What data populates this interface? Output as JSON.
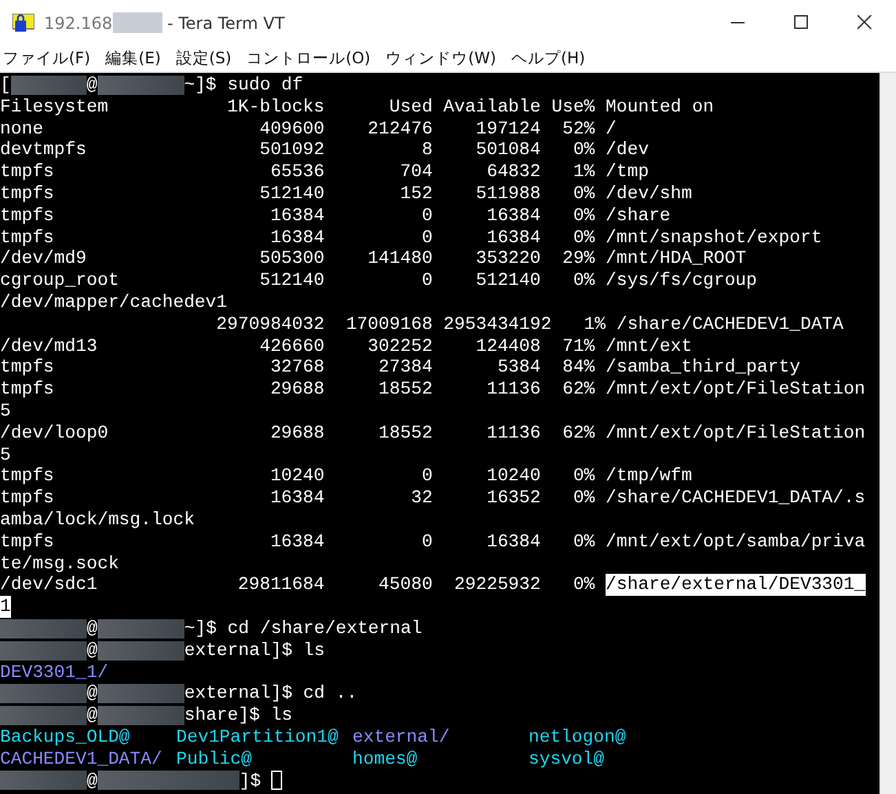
{
  "window": {
    "title_prefix": "192.168",
    "title_suffix": " - Tera Term VT"
  },
  "menu": [
    "ファイル(F)",
    "編集(E)",
    "設定(S)",
    "コントロール(O)",
    "ウィンドウ(W)",
    "ヘルプ(H)"
  ],
  "terminal": {
    "lines": [
      {
        "segments": [
          {
            "kind": "text",
            "text": "["
          },
          {
            "kind": "redacted_short"
          },
          {
            "kind": "text",
            "text": "@"
          },
          {
            "kind": "redacted"
          },
          {
            "kind": "text",
            "text": "~]$ sudo df"
          }
        ]
      },
      {
        "segments": [
          {
            "kind": "text",
            "text": "Filesystem           1K-blocks      Used Available Use% Mounted on"
          }
        ]
      },
      {
        "segments": [
          {
            "kind": "text",
            "text": "none                    409600    212476    197124  52% /"
          }
        ]
      },
      {
        "segments": [
          {
            "kind": "text",
            "text": "devtmpfs                501092         8    501084   0% /dev"
          }
        ]
      },
      {
        "segments": [
          {
            "kind": "text",
            "text": "tmpfs                    65536       704     64832   1% /tmp"
          }
        ]
      },
      {
        "segments": [
          {
            "kind": "text",
            "text": "tmpfs                   512140       152    511988   0% /dev/shm"
          }
        ]
      },
      {
        "segments": [
          {
            "kind": "text",
            "text": "tmpfs                    16384         0     16384   0% /share"
          }
        ]
      },
      {
        "segments": [
          {
            "kind": "text",
            "text": "tmpfs                    16384         0     16384   0% /mnt/snapshot/export"
          }
        ]
      },
      {
        "segments": [
          {
            "kind": "text",
            "text": "/dev/md9                505300    141480    353220  29% /mnt/HDA_ROOT"
          }
        ]
      },
      {
        "segments": [
          {
            "kind": "text",
            "text": "cgroup_root             512140         0    512140   0% /sys/fs/cgroup"
          }
        ]
      },
      {
        "segments": [
          {
            "kind": "text",
            "text": "/dev/mapper/cachedev1"
          }
        ]
      },
      {
        "segments": [
          {
            "kind": "text",
            "text": "                    2970984032  17009168 2953434192   1% /share/CACHEDEV1_DATA"
          }
        ]
      },
      {
        "segments": [
          {
            "kind": "text",
            "text": "/dev/md13               426660    302252    124408  71% /mnt/ext"
          }
        ]
      },
      {
        "segments": [
          {
            "kind": "text",
            "text": "tmpfs                    32768     27384      5384  84% /samba_third_party"
          }
        ]
      },
      {
        "segments": [
          {
            "kind": "text",
            "text": "tmpfs                    29688     18552     11136  62% /mnt/ext/opt/FileStation"
          }
        ]
      },
      {
        "segments": [
          {
            "kind": "text",
            "text": "5"
          }
        ]
      },
      {
        "segments": [
          {
            "kind": "text",
            "text": "/dev/loop0               29688     18552     11136  62% /mnt/ext/opt/FileStation"
          }
        ]
      },
      {
        "segments": [
          {
            "kind": "text",
            "text": "5"
          }
        ]
      },
      {
        "segments": [
          {
            "kind": "text",
            "text": "tmpfs                    10240         0     10240   0% /tmp/wfm"
          }
        ]
      },
      {
        "segments": [
          {
            "kind": "text",
            "text": "tmpfs                    16384        32     16352   0% /share/CACHEDEV1_DATA/.s"
          }
        ]
      },
      {
        "segments": [
          {
            "kind": "text",
            "text": "amba/lock/msg.lock"
          }
        ]
      },
      {
        "segments": [
          {
            "kind": "text",
            "text": "tmpfs                    16384         0     16384   0% /mnt/ext/opt/samba/priva"
          }
        ]
      },
      {
        "segments": [
          {
            "kind": "text",
            "text": "te/msg.sock"
          }
        ]
      },
      {
        "segments": [
          {
            "kind": "text",
            "text": "/dev/sdc1             29811684     45080  29225932   0% "
          },
          {
            "kind": "selected",
            "text": "/share/external/DEV3301_"
          }
        ]
      },
      {
        "segments": [
          {
            "kind": "selected",
            "text": "1"
          }
        ]
      },
      {
        "segments": [
          {
            "kind": "redacted"
          },
          {
            "kind": "text",
            "text": "@"
          },
          {
            "kind": "redacted"
          },
          {
            "kind": "text",
            "text": "~]$ cd /share/external"
          }
        ]
      },
      {
        "segments": [
          {
            "kind": "redacted"
          },
          {
            "kind": "text",
            "text": "@"
          },
          {
            "kind": "redacted"
          },
          {
            "kind": "text",
            "text": "external]$ ls"
          }
        ]
      },
      {
        "segments": [
          {
            "kind": "dir",
            "text": "DEV3301_1/"
          }
        ]
      },
      {
        "segments": [
          {
            "kind": "redacted"
          },
          {
            "kind": "text",
            "text": "@"
          },
          {
            "kind": "redacted"
          },
          {
            "kind": "text",
            "text": "external]$ cd .."
          }
        ]
      },
      {
        "segments": [
          {
            "kind": "redacted"
          },
          {
            "kind": "text",
            "text": "@"
          },
          {
            "kind": "redacted"
          },
          {
            "kind": "text",
            "text": "share]$ ls"
          }
        ]
      },
      {
        "segments": [
          {
            "kind": "link",
            "text": "Backups_OLD@"
          },
          {
            "kind": "link",
            "text": "Dev1Partition1@"
          },
          {
            "kind": "dir",
            "text": "external/"
          },
          {
            "kind": "link",
            "text": "netlogon@"
          }
        ]
      },
      {
        "segments": [
          {
            "kind": "dir",
            "text": "CACHEDEV1_DATA/"
          },
          {
            "kind": "link",
            "text": "Public@"
          },
          {
            "kind": "link",
            "text": "homes@"
          },
          {
            "kind": "link",
            "text": "sysvol@"
          }
        ]
      },
      {
        "segments": [
          {
            "kind": "redacted"
          },
          {
            "kind": "text",
            "text": "@"
          },
          {
            "kind": "redacted_long"
          },
          {
            "kind": "text",
            "text": "]$ "
          },
          {
            "kind": "cursor"
          }
        ]
      }
    ]
  }
}
